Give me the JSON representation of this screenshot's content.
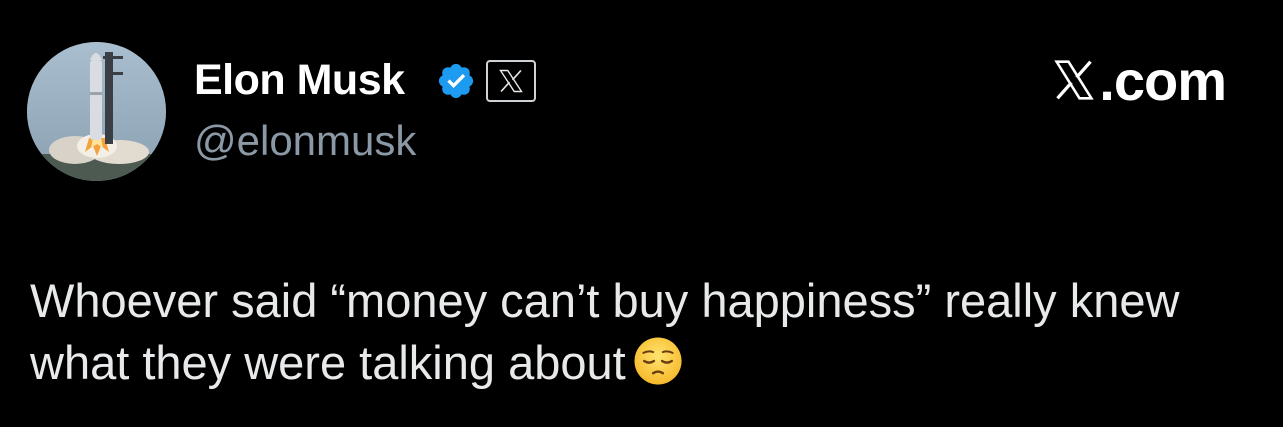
{
  "tweet": {
    "author": {
      "display_name": "Elon Musk",
      "handle": "@elonmusk",
      "avatar_icon": "rocket-launch-avatar",
      "verified_icon": "verified-badge-icon",
      "verified_color": "#1d9bf0",
      "affiliate_icon": "x-logo-badge-icon"
    },
    "brand": {
      "text": ".com",
      "logo_icon": "x-logo-icon"
    },
    "text": "Whoever said “money can’t buy happiness” really knew what they were talking about",
    "emoji": "pensive-face-emoji"
  },
  "colors": {
    "background": "#000000",
    "primary_text": "#e7e9ea",
    "secondary_text": "#8b98a5",
    "accent": "#1d9bf0"
  }
}
